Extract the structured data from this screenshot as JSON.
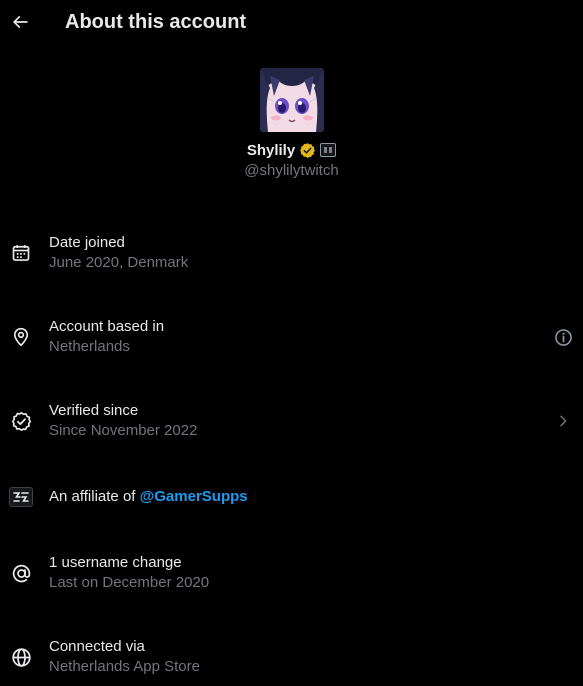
{
  "header": {
    "title": "About this account"
  },
  "profile": {
    "display_name": "Shylily",
    "handle": "@shylilytwitch",
    "verified_badge_color": "#e2b719"
  },
  "rows": [
    {
      "id": "date-joined",
      "icon": "calendar-icon",
      "title": "Date joined",
      "subtitle": "June 2020, Denmark"
    },
    {
      "id": "account-based-in",
      "icon": "location-pin-icon",
      "title": "Account based in",
      "subtitle": "Netherlands",
      "right_icon": "info-icon"
    },
    {
      "id": "verified-since",
      "icon": "verified-check-icon",
      "title": "Verified since",
      "subtitle": "Since November 2022",
      "right_icon": "chevron-right-icon"
    },
    {
      "id": "affiliate",
      "icon": "affiliate-badge-icon",
      "title_prefix": "An affiliate of ",
      "title_link": "@GamerSupps"
    },
    {
      "id": "username-change",
      "icon": "at-sign-icon",
      "title": "1 username change",
      "subtitle": "Last on December 2020"
    },
    {
      "id": "connected-via",
      "icon": "globe-icon",
      "title": "Connected via",
      "subtitle": "Netherlands App Store"
    }
  ],
  "colors": {
    "background": "#000000",
    "primary_text": "#e7e9ea",
    "secondary_text": "#71767b",
    "link": "#1d9bf0"
  }
}
